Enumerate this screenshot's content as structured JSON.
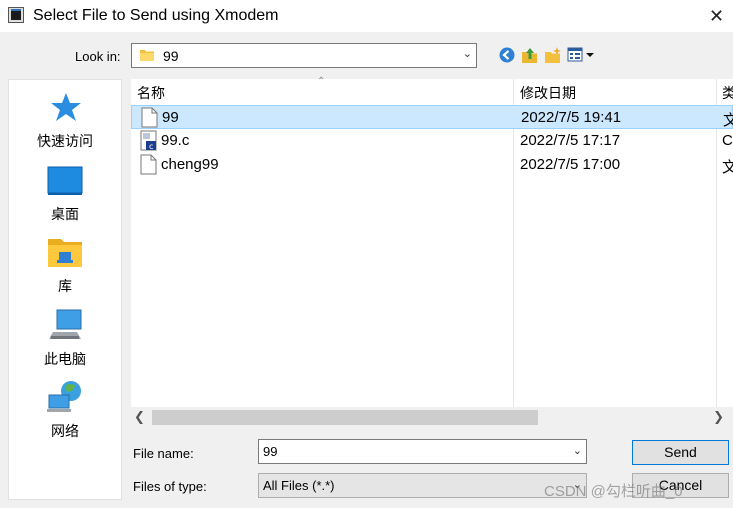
{
  "window": {
    "title": "Select File to Send using Xmodem",
    "close_glyph": "✕"
  },
  "look_in": {
    "label": "Look in:",
    "value": "99"
  },
  "places": [
    {
      "label": "快速访问",
      "icon": "star-icon"
    },
    {
      "label": "桌面",
      "icon": "desktop-icon"
    },
    {
      "label": "库",
      "icon": "library-icon"
    },
    {
      "label": "此电脑",
      "icon": "computer-icon"
    },
    {
      "label": "网络",
      "icon": "network-icon"
    }
  ],
  "file_list": {
    "columns": [
      "名称",
      "修改日期",
      "类"
    ],
    "rows": [
      {
        "name": "99",
        "date": "2022/7/5 19:41",
        "type": "文",
        "icon": "blank-file-icon",
        "selected": true
      },
      {
        "name": "99.c",
        "date": "2022/7/5 17:17",
        "type": "C",
        "icon": "c-source-file-icon",
        "selected": false
      },
      {
        "name": "cheng99",
        "date": "2022/7/5 17:00",
        "type": "文",
        "icon": "blank-file-icon",
        "selected": false
      }
    ]
  },
  "form": {
    "file_name_label": "File name:",
    "file_name_value": "99",
    "file_type_label": "Files of type:",
    "file_type_value": "All Files (*.*)",
    "send_label": "Send",
    "cancel_label": "Cancel"
  },
  "watermark": "CSDN @勾栏听曲_0",
  "colors": {
    "selection": "#cce8ff",
    "accent": "#0078d7"
  }
}
